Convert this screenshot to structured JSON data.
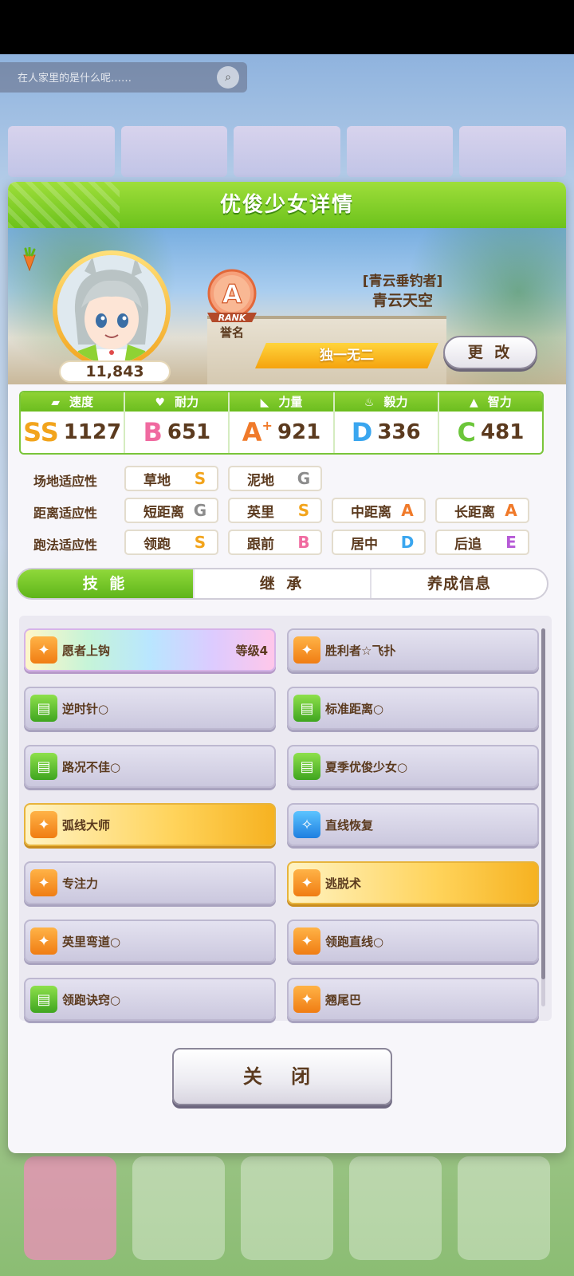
{
  "background": {
    "search_placeholder": "在人家里的是什么呢……",
    "dock": [
      "",
      "",
      "",
      "",
      ""
    ]
  },
  "dialog": {
    "title": "优俊少女详情",
    "fans": "11,843",
    "rank": {
      "letter": "A",
      "word": "RANK",
      "name": "誉名"
    },
    "epithet": "[青云垂钓者]",
    "name": "青云天空",
    "unique": "独一无二",
    "change_label": "更 改"
  },
  "stats": [
    {
      "label": "速度",
      "icon": "shoe-icon",
      "grade": "SS",
      "value": "1127",
      "color": "#f2a41c"
    },
    {
      "label": "耐力",
      "icon": "heart-icon",
      "grade": "B",
      "value": "651",
      "color": "#f06aa0"
    },
    {
      "label": "力量",
      "icon": "muscle-icon",
      "grade": "A",
      "grade_plus": "+",
      "value": "921",
      "color": "#f07a2a"
    },
    {
      "label": "毅力",
      "icon": "flame-icon",
      "grade": "D",
      "value": "336",
      "color": "#3aa6ef"
    },
    {
      "label": "智力",
      "icon": "mortarboard-icon",
      "grade": "C",
      "value": "481",
      "color": "#6cc63a"
    }
  ],
  "aptitude": {
    "track": {
      "label": "场地适应性",
      "items": [
        {
          "name": "草地",
          "grade": "S",
          "color": "#f2a41c"
        },
        {
          "name": "泥地",
          "grade": "G",
          "color": "#8c8c8c"
        }
      ]
    },
    "distance": {
      "label": "距离适应性",
      "items": [
        {
          "name": "短距离",
          "grade": "G",
          "color": "#8c8c8c"
        },
        {
          "name": "英里",
          "grade": "S",
          "color": "#f2a41c"
        },
        {
          "name": "中距离",
          "grade": "A",
          "color": "#f07a2a"
        },
        {
          "name": "长距离",
          "grade": "A",
          "color": "#f07a2a"
        }
      ]
    },
    "style": {
      "label": "跑法适应性",
      "items": [
        {
          "name": "领跑",
          "grade": "S",
          "color": "#f2a41c"
        },
        {
          "name": "跟前",
          "grade": "B",
          "color": "#f06aa0"
        },
        {
          "name": "居中",
          "grade": "D",
          "color": "#3aa6ef"
        },
        {
          "name": "后追",
          "grade": "E",
          "color": "#b65ad6"
        }
      ]
    }
  },
  "tabs": [
    "技 能",
    "继 承",
    "养成信息"
  ],
  "skills": [
    {
      "name": "愿者上钩",
      "level": "等级4",
      "style": "rainbow",
      "icon": "orange"
    },
    {
      "name": "胜利者☆飞扑",
      "level": "",
      "style": "plain",
      "icon": "orange"
    },
    {
      "name": "逆时针○",
      "level": "",
      "style": "plain",
      "icon": "green"
    },
    {
      "name": "标准距离○",
      "level": "",
      "style": "plain",
      "icon": "green"
    },
    {
      "name": "路况不佳○",
      "level": "",
      "style": "plain",
      "icon": "green"
    },
    {
      "name": "夏季优俊少女○",
      "level": "",
      "style": "plain",
      "icon": "green"
    },
    {
      "name": "弧线大师",
      "level": "",
      "style": "gold",
      "icon": "orange"
    },
    {
      "name": "直线恢复",
      "level": "",
      "style": "plain",
      "icon": "blue"
    },
    {
      "name": "专注力",
      "level": "",
      "style": "plain",
      "icon": "orange"
    },
    {
      "name": "逃脱术",
      "level": "",
      "style": "gold",
      "icon": "orange"
    },
    {
      "name": "英里弯道○",
      "level": "",
      "style": "plain",
      "icon": "orange"
    },
    {
      "name": "领跑直线○",
      "level": "",
      "style": "plain",
      "icon": "orange"
    },
    {
      "name": "领跑诀窍○",
      "level": "",
      "style": "plain",
      "icon": "green"
    },
    {
      "name": "翘尾巴",
      "level": "",
      "style": "plain",
      "icon": "orange"
    }
  ],
  "close_label": "关 闭"
}
